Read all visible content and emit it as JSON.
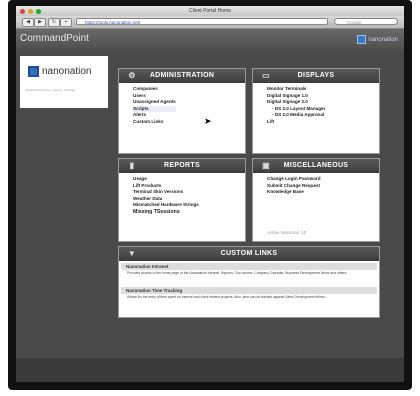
{
  "browser": {
    "window_title": "Client Portal Home",
    "url": "https://tools.nanonation.net/",
    "search_placeholder": "Google"
  },
  "app": {
    "name": "CommandPoint",
    "brand": "nanonation"
  },
  "sidebar": {
    "logo_text": "nanonation",
    "caption": "Dashboard Home · Logout · Settings"
  },
  "administration": {
    "title": "ADMINISTRATION",
    "items": [
      "Companies",
      "Users",
      "Unassigned Agents",
      "Scripts",
      "Alerts",
      "Custom Links"
    ]
  },
  "displays": {
    "title": "DISPLAYS",
    "items": [
      "Monitor Terminals",
      "Digital Signage 1.0",
      "Digital Signage 2.0",
      "- DS 2.0 Layout Manager",
      "- DS 2.0 Media Approval",
      "Lift"
    ]
  },
  "reports": {
    "title": "REPORTS",
    "items": [
      "Usage",
      "Lift Products",
      "Terminal Skin Versions",
      "Weather Data",
      "Mismatched Hardware Strings",
      "Missing TSessions"
    ]
  },
  "misc": {
    "title": "MISCELLANEOUS",
    "items": [
      "Change Login Password",
      "Submit Change Request",
      "Knowledge Base"
    ],
    "active_sessions": "Active Sessions: 10"
  },
  "custom_links": {
    "title": "CUSTOM LINKS",
    "links": [
      {
        "name": "Nanonation Intranet",
        "description": "Provides access to the home page of the Nanonation Intranet. Reports, Tool access, Company Calendar, Business Development News and others."
      },
      {
        "name": "Nanonation Time Tracking",
        "description": "Allows for the entry of time spent on internal and client related projects. Also, time can be tracked against Sales Development efforts."
      }
    ]
  },
  "colors": {
    "header_dark": "#3c3c3c",
    "brand_blue": "#2f6fbf",
    "page_bg": "#4a4a4a"
  }
}
